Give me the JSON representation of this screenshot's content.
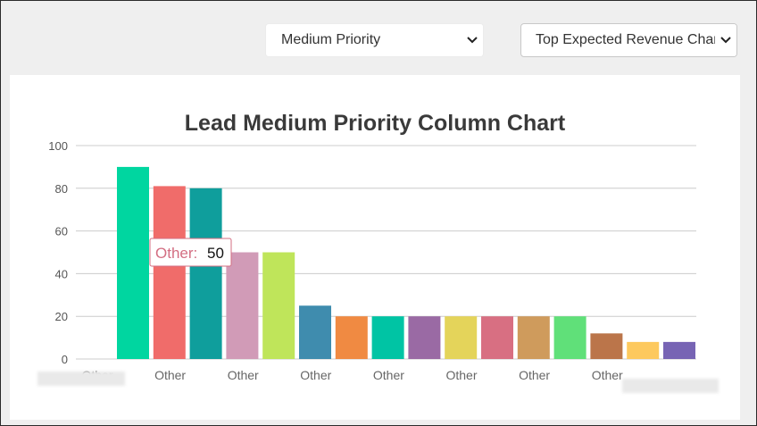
{
  "controls": {
    "priority_select": "Medium Priority",
    "chart_type_select": "Top Expected Revenue Chart"
  },
  "colors": {
    "background": "#efefef",
    "card": "#ffffff",
    "gridline": "#cccccc",
    "tooltip_border": "#d36e82",
    "tooltip_label": "#d36e82"
  },
  "tooltip": {
    "label": "Other:",
    "value": "50"
  },
  "chart_data": {
    "type": "bar",
    "title": "Lead Medium Priority Column Chart",
    "xlabel": "",
    "ylabel": "",
    "ylim": [
      0,
      100
    ],
    "yticks": [
      0,
      20,
      40,
      60,
      80,
      100
    ],
    "grid": true,
    "legend": "none",
    "categories": [
      "Other",
      "Other",
      "Other",
      "Other",
      "Other",
      "Other",
      "Other",
      "Other",
      "Other",
      "Other",
      "Other",
      "Other",
      "Other",
      "Other",
      "Other",
      "Other"
    ],
    "values": [
      90,
      81,
      80,
      50,
      50,
      25,
      20,
      20,
      20,
      20,
      20,
      20,
      20,
      12,
      8,
      8
    ],
    "bar_colors": [
      "#00d6a0",
      "#f06c6a",
      "#0f9e9c",
      "#d19bb7",
      "#bfe55a",
      "#3f8cae",
      "#f08a42",
      "#00c4a4",
      "#9a6aa4",
      "#e4d45a",
      "#d86f82",
      "#cf9b5c",
      "#60e079",
      "#bb754a",
      "#fdc95e",
      "#7764b4"
    ]
  }
}
